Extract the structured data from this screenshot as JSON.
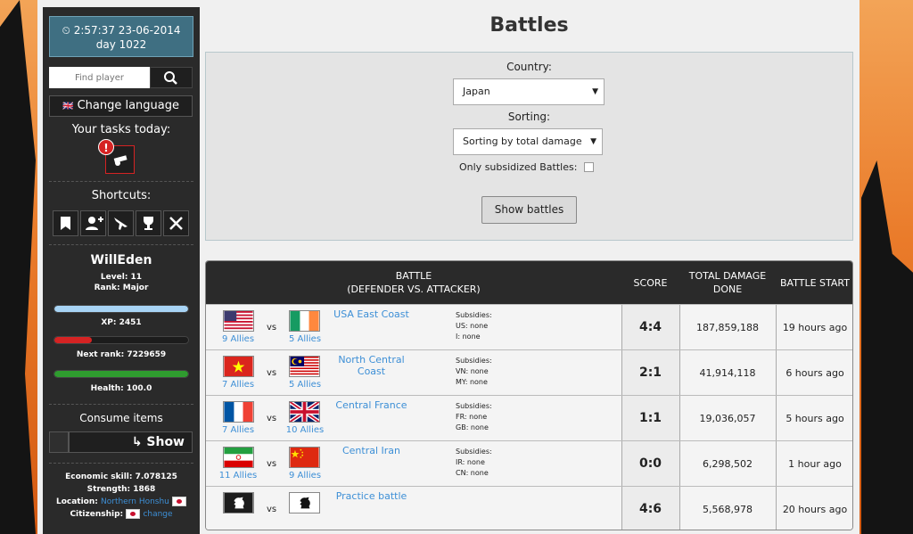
{
  "sidebar": {
    "clock_time": "2:57:37 23-06-2014",
    "clock_day": "day 1022",
    "search_placeholder": "Find player",
    "change_language": "Change language",
    "tasks_title": "Your tasks today:",
    "task_badge": "!",
    "shortcuts_title": "Shortcuts:",
    "shortcuts": [
      "bookmark-icon",
      "user-add-icon",
      "jet-icon",
      "trophy-icon",
      "tools-icon"
    ],
    "username": "WillEden",
    "level": "Level: 11",
    "rank": "Rank: Major",
    "xp_label": "XP:  2451",
    "xp_fill": 1.0,
    "next_rank_label": "Next rank:  7229659",
    "rank_fill": 0.28,
    "health_label": "Health:  100.0",
    "health_fill": 1.0,
    "consume_title": "Consume items",
    "show_label": "Show",
    "economic_skill": "Economic skill: 7.078125",
    "strength": "Strength: 1868",
    "location_label": "Location:",
    "location_value": "Northern Honshu",
    "citizenship_label": "Citizenship:",
    "citizenship_change": "change"
  },
  "page_title": "Battles",
  "filter": {
    "country_label": "Country:",
    "country_value": "Japan",
    "sorting_label": "Sorting:",
    "sorting_value": "Sorting by total damage",
    "subsidized_label": "Only subsidized Battles:",
    "show_button": "Show battles"
  },
  "table": {
    "headers": {
      "battle_line1": "BATTLE",
      "battle_line2": "(DEFENDER VS. ATTACKER)",
      "score": "SCORE",
      "damage_line1": "TOTAL DAMAGE",
      "damage_line2": "DONE",
      "start": "BATTLE START"
    },
    "vs": "vs",
    "rows": [
      {
        "def_flag": "flag-us",
        "def_allies": "9 Allies",
        "att_flag": "flag-ie",
        "att_allies": "5 Allies",
        "region": "USA East Coast",
        "subs_title": "Subsidies:",
        "subs_1": "US: none",
        "subs_2": "I: none",
        "score": "4:4",
        "damage": "187,859,188",
        "start": "19 hours ago"
      },
      {
        "def_flag": "flag-vn",
        "def_allies": "7 Allies",
        "att_flag": "flag-my",
        "att_allies": "5 Allies",
        "region": "North Central Coast",
        "subs_title": "Subsidies:",
        "subs_1": "VN: none",
        "subs_2": "MY: none",
        "score": "2:1",
        "damage": "41,914,118",
        "start": "6 hours ago"
      },
      {
        "def_flag": "flag-fr",
        "def_allies": "7 Allies",
        "att_flag": "flag-gb",
        "att_allies": "10 Allies",
        "region": "Central France",
        "subs_title": "Subsidies:",
        "subs_1": "FR: none",
        "subs_2": "GB: none",
        "score": "1:1",
        "damage": "19,036,057",
        "start": "5 hours ago"
      },
      {
        "def_flag": "flag-ir",
        "def_allies": "11 Allies",
        "att_flag": "flag-cn",
        "att_allies": "9 Allies",
        "region": "Central Iran",
        "subs_title": "Subsidies:",
        "subs_1": "IR: none",
        "subs_2": "CN: none",
        "score": "0:0",
        "damage": "6,298,502",
        "start": "1 hour ago"
      },
      {
        "def_flag": "flag-practice-white",
        "def_allies": "",
        "att_flag": "flag-practice-black",
        "att_allies": "",
        "region": "Practice battle",
        "subs_title": "",
        "subs_1": "",
        "subs_2": "",
        "score": "4:6",
        "damage": "5,568,978",
        "start": "20 hours ago"
      }
    ]
  },
  "colors": {
    "accent_blue": "#3d8fd6",
    "xp_bar": "#a8d4f5",
    "rank_bar": "#d52323",
    "health_bar": "#2f9c2f",
    "task_border": "#d52323"
  }
}
